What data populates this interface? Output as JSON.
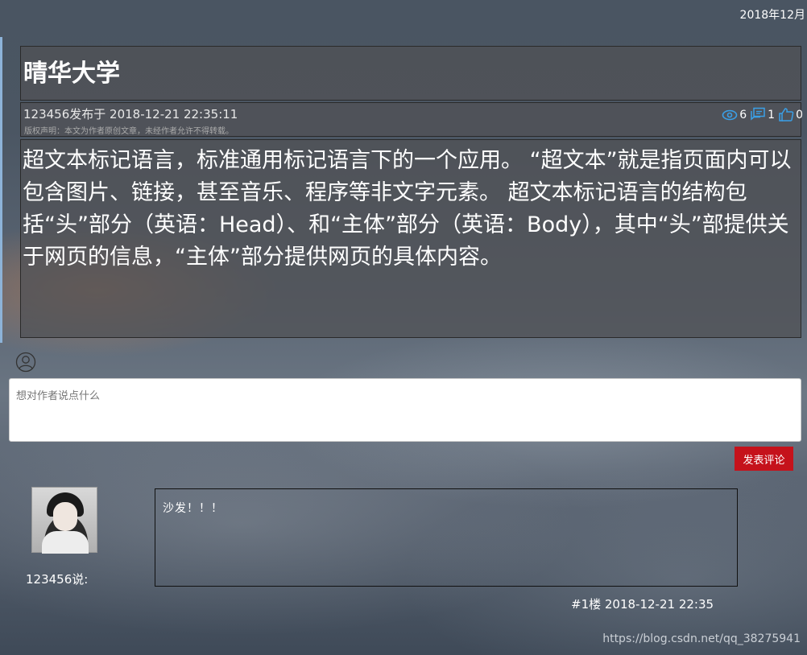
{
  "header": {
    "date_top": "2018年12月"
  },
  "article": {
    "title": "晴华大学",
    "meta": "123456发布于 2018-12-21 22:35:11",
    "copyright": "版权声明：本文为作者原创文章，未经作者允许不得转载。",
    "stats": {
      "views": "6",
      "comments": "1",
      "likes": "0"
    },
    "body": "  超文本标记语言，标准通用标记语言下的一个应用。 “超文本”就是指页面内可以包含图片、链接，甚至音乐、程序等非文字元素。 超文本标记语言的结构包括“头”部分（英语：Head）、和“主体”部分（英语：Body），其中“头”部提供关于网页的信息，“主体”部分提供网页的具体内容。"
  },
  "comment_form": {
    "placeholder": "想对作者说点什么",
    "submit_label": "发表评论"
  },
  "comments": [
    {
      "user_label": "123456说:",
      "text": "沙发！！！",
      "floor": "#1楼 2018-12-21 22:35"
    }
  ],
  "watermark": "https://blog.csdn.net/qq_38275941",
  "colors": {
    "submit": "#c5121b",
    "stat_icon": "#3aa0e8"
  }
}
